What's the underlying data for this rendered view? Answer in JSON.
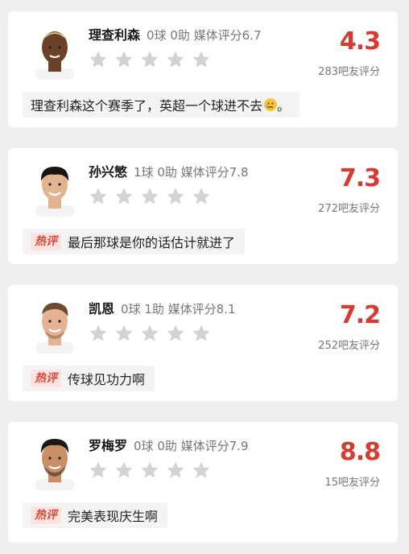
{
  "players": [
    {
      "name": "理查利森",
      "stats": "0球 0助  媒体评分6.7",
      "score": "4.3",
      "rating_count": "283吧友评分",
      "comment_hot": false,
      "comment_text": "理查利森这个赛季了，英超一个球进不去",
      "comment_suffix": "。",
      "comment_emoji": "crying-face-icon",
      "skin": "#6b4227",
      "hair": "#d8b98a"
    },
    {
      "name": "孙兴慜",
      "stats": "1球 0助  媒体评分7.8",
      "score": "7.3",
      "rating_count": "272吧友评分",
      "comment_hot": true,
      "hot_label": "热评",
      "comment_text": "最后那球是你的话估计就进了",
      "skin": "#e0b48e",
      "hair": "#1a1410"
    },
    {
      "name": "凯恩",
      "stats": "0球 1助  媒体评分8.1",
      "score": "7.2",
      "rating_count": "252吧友评分",
      "comment_hot": true,
      "hot_label": "热评",
      "comment_text": "传球见功力啊",
      "skin": "#e4b394",
      "hair": "#6b4a2e"
    },
    {
      "name": "罗梅罗",
      "stats": "0球 0助  媒体评分7.9",
      "score": "8.8",
      "rating_count": "15吧友评分",
      "comment_hot": true,
      "hot_label": "热评",
      "comment_text": "完美表现庆生啊",
      "skin": "#c99068",
      "hair": "#1e1712"
    }
  ],
  "colors": {
    "accent": "#d63b32",
    "star_empty": "#d3d3d3",
    "card_bg": "#ffffff",
    "page_bg": "#efefef"
  }
}
